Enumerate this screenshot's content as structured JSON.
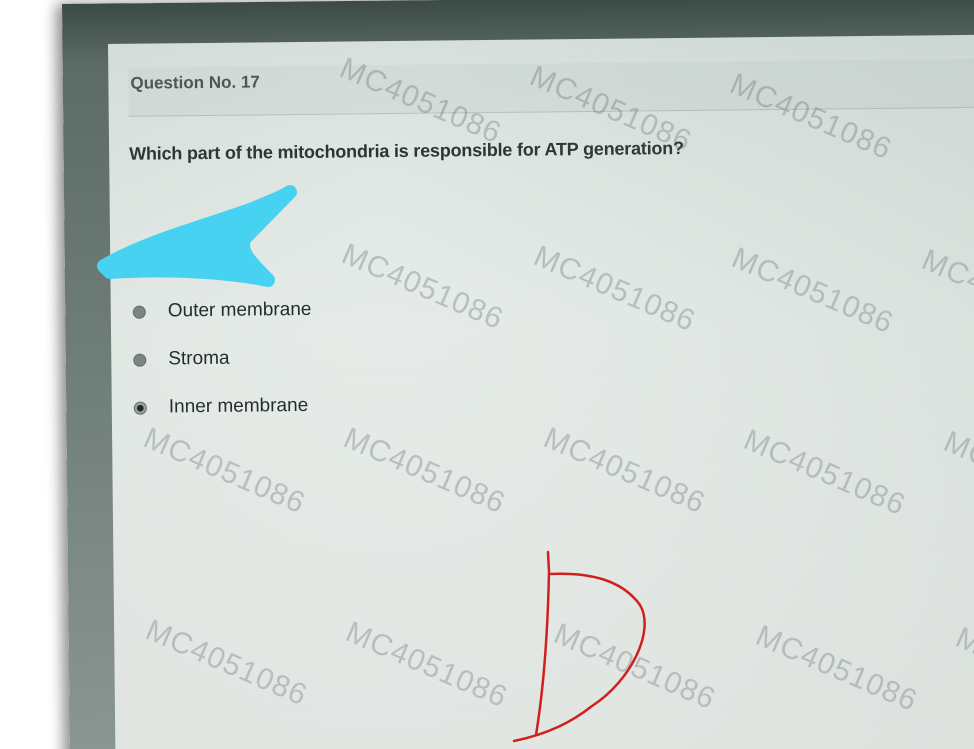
{
  "question": {
    "title": "Question No. 17",
    "text": "Which part of the mitochondria is responsible for ATP generation?"
  },
  "options": [
    {
      "label": "Outer membrane",
      "selected": false
    },
    {
      "label": "Stroma",
      "selected": false
    },
    {
      "label": "Inner membrane",
      "selected": true
    }
  ],
  "watermark": "MC4051086",
  "colors": {
    "highlight_scribble": "#46d2f0",
    "pen_mark": "#d0201e"
  }
}
